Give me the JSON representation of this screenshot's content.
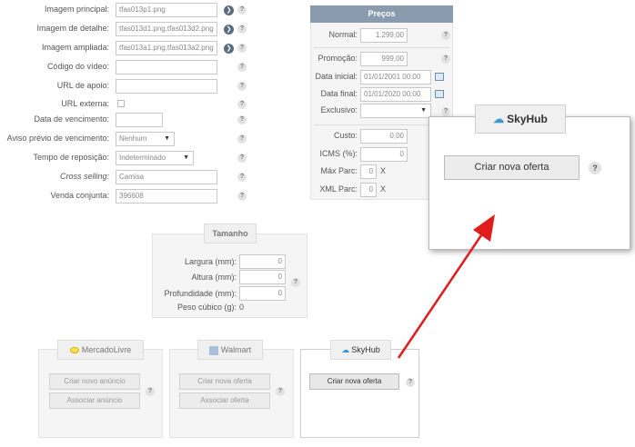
{
  "form": {
    "imagem_principal": {
      "label": "Imagem principal:",
      "value": "tfas013p1.png"
    },
    "imagem_detalhe": {
      "label": "Imagem de detalhe:",
      "value": "tfas013d1.png,tfas013d2.png"
    },
    "imagem_ampliada": {
      "label": "Imagem ampliada:",
      "value": "tfas013a1.png,tfas013a2.png"
    },
    "codigo_video": {
      "label": "Código do vídeo:",
      "value": ""
    },
    "url_apoio": {
      "label": "URL de apoio:",
      "value": ""
    },
    "url_externa": {
      "label": "URL externa:"
    },
    "data_vencimento": {
      "label": "Data de vencimento:",
      "value": ""
    },
    "aviso_previo": {
      "label": "Aviso prévio de vencimento:",
      "value": "Nenhum"
    },
    "tempo_reposicao": {
      "label": "Tempo de reposição:",
      "value": "Indeterminado"
    },
    "cross_selling": {
      "label": "Cross selling:",
      "value": "Camisa"
    },
    "venda_conjunta": {
      "label": "Venda conjunta:",
      "value": "396608"
    }
  },
  "precos": {
    "title": "Preços",
    "normal": {
      "label": "Normal:",
      "value": "1.299,00"
    },
    "promocao": {
      "label": "Promoção:",
      "value": "999,00"
    },
    "data_inicial": {
      "label": "Data inicial:",
      "value": "01/01/2001 00:00"
    },
    "data_final": {
      "label": "Data final:",
      "value": "01/01/2020 00:00"
    },
    "exclusivo": {
      "label": "Exclusivo:",
      "value": ""
    },
    "custo": {
      "label": "Custo:",
      "value": "0,00"
    },
    "icms": {
      "label": "ICMS (%):",
      "value": "0"
    },
    "max_parc": {
      "label": "Máx Parc:",
      "value": "0",
      "suffix": "X"
    },
    "xml_parc": {
      "label": "XML Parc:",
      "value": "0",
      "suffix": "X"
    }
  },
  "tamanho": {
    "title": "Tamanho",
    "largura": {
      "label": "Largura (mm):",
      "value": "0"
    },
    "altura": {
      "label": "Altura (mm):",
      "value": "0"
    },
    "profundidade": {
      "label": "Profundidade (mm):",
      "value": "0"
    },
    "peso_cubico": {
      "label": "Peso cúbico (g):",
      "value": "0"
    }
  },
  "marketplaces": {
    "mercadolivre": {
      "title": "MercadoLivre",
      "btn1": "Criar novo anúncio",
      "btn2": "Associar anúncio"
    },
    "walmart": {
      "title": "Walmart",
      "btn1": "Criar nova oferta",
      "btn2": "Associar oferta"
    },
    "skyhub": {
      "title": "SkyHub",
      "btn1": "Criar nova oferta"
    }
  },
  "zoom": {
    "title": "SkyHub",
    "button": "Criar nova oferta"
  },
  "icons": {
    "help": "?",
    "go": "❯"
  },
  "colors": {
    "header_bg": "#8a9bb0",
    "arrow": "#e01c1c"
  }
}
